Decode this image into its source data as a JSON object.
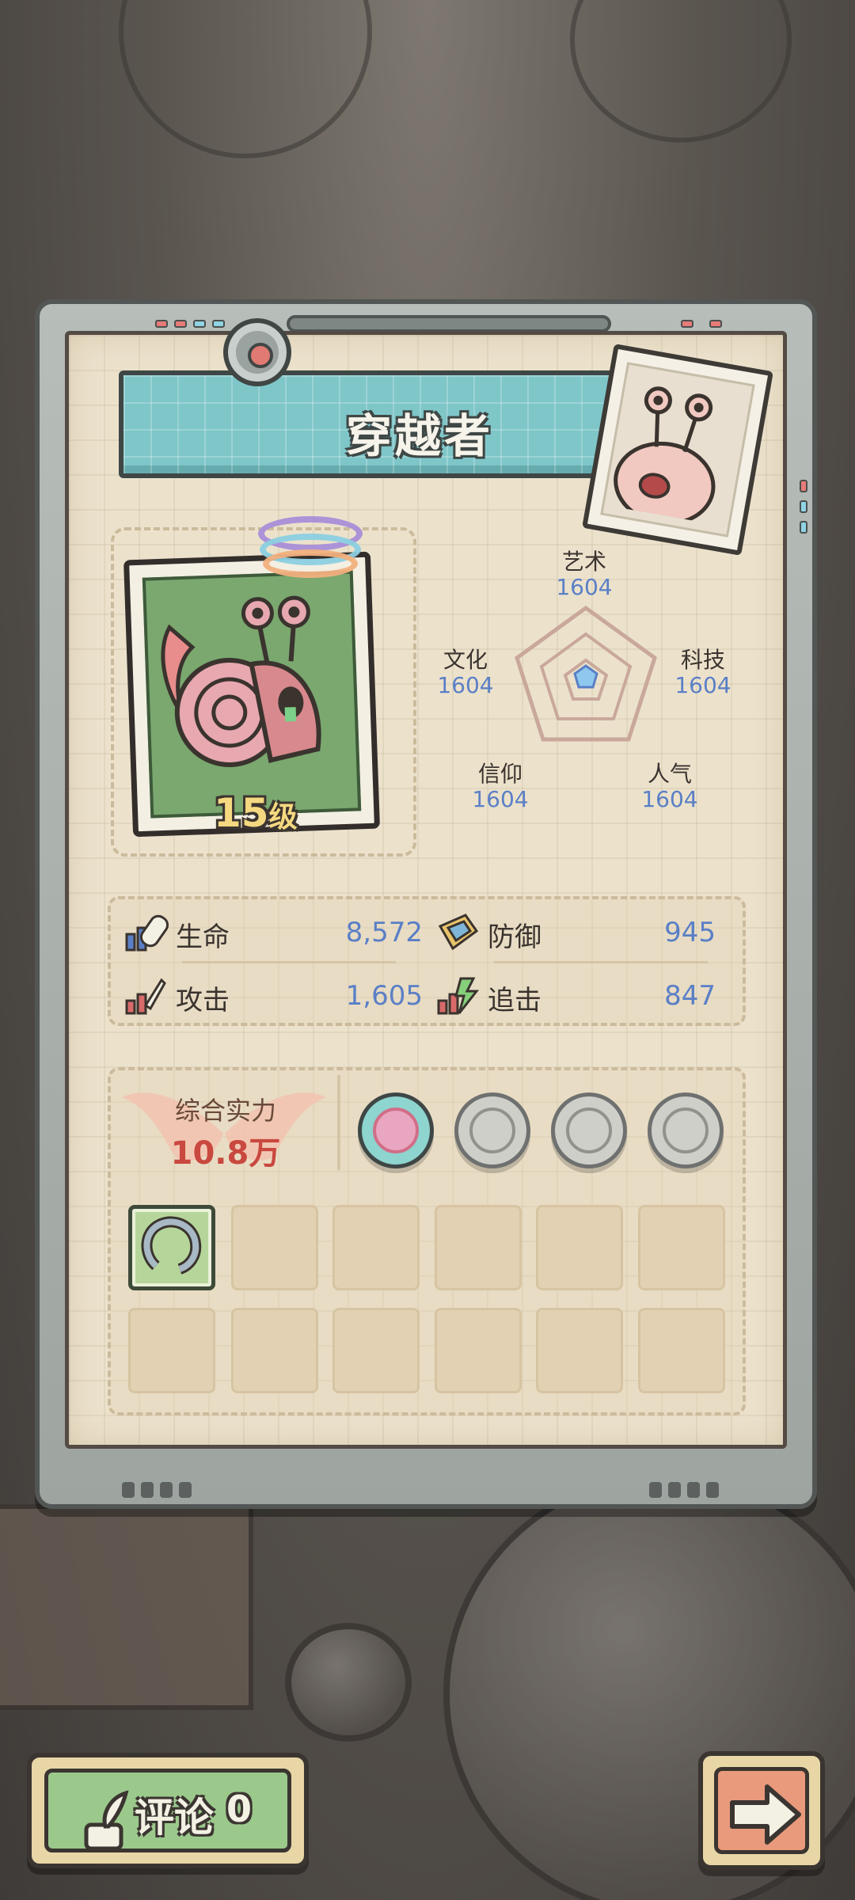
{
  "character": {
    "name": "穿越者",
    "level": "15",
    "level_suffix": "级"
  },
  "attributes": {
    "art": {
      "label": "艺术",
      "value": "1604"
    },
    "culture": {
      "label": "文化",
      "value": "1604"
    },
    "tech": {
      "label": "科技",
      "value": "1604"
    },
    "faith": {
      "label": "信仰",
      "value": "1604"
    },
    "fame": {
      "label": "人气",
      "value": "1604"
    }
  },
  "stats": {
    "hp": {
      "label": "生命",
      "value": "8,572"
    },
    "defense": {
      "label": "防御",
      "value": "945"
    },
    "attack": {
      "label": "攻击",
      "value": "1,605"
    },
    "pursuit": {
      "label": "追击",
      "value": "847"
    }
  },
  "power": {
    "label": "综合实力",
    "value": "10.8万"
  },
  "medals": [
    {
      "icon": "dragon-medal-icon",
      "active": true
    },
    {
      "icon": "scroll-medal-icon",
      "active": false
    },
    {
      "icon": "rope-medal-icon",
      "active": false
    },
    {
      "icon": "monster-medal-icon",
      "active": false
    }
  ],
  "inventory": {
    "slots_total": 12,
    "filled": [
      {
        "index": 0,
        "icon": "horseshoe-item-icon"
      }
    ]
  },
  "comment_button": {
    "label": "评论",
    "count": "0",
    "icon": "quill-icon"
  },
  "next_button": {
    "icon": "arrow-right-icon"
  },
  "colors": {
    "accent_blue": "#5a7fc6",
    "power_red": "#c9483f",
    "banner_teal": "#7fc6c9",
    "comment_green": "#9bc98c",
    "next_orange": "#e99a7c"
  }
}
